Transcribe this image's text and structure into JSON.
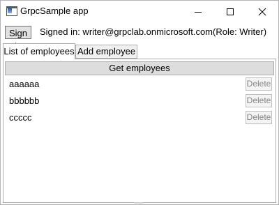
{
  "window": {
    "title": "GrpcSample app",
    "icon": "app-window-icon",
    "controls": {
      "minimize": "minimize-icon",
      "maximize": "maximize-icon",
      "close": "close-icon"
    }
  },
  "header": {
    "signin_label": "Sign in",
    "signed_in_text": "Signed in: writer@grpclab.onmicrosoft.com(Role: Writer)"
  },
  "tabs": [
    {
      "label": "List of employees",
      "selected": true
    },
    {
      "label": "Add employee",
      "selected": false
    }
  ],
  "employees_panel": {
    "get_button_label": "Get employees",
    "employees": [
      {
        "name": "aaaaaa",
        "delete_label": "Delete",
        "delete_enabled": false
      },
      {
        "name": "bbbbbb",
        "delete_label": "Delete",
        "delete_enabled": false
      },
      {
        "name": "ccccc",
        "delete_label": "Delete",
        "delete_enabled": false
      }
    ]
  }
}
